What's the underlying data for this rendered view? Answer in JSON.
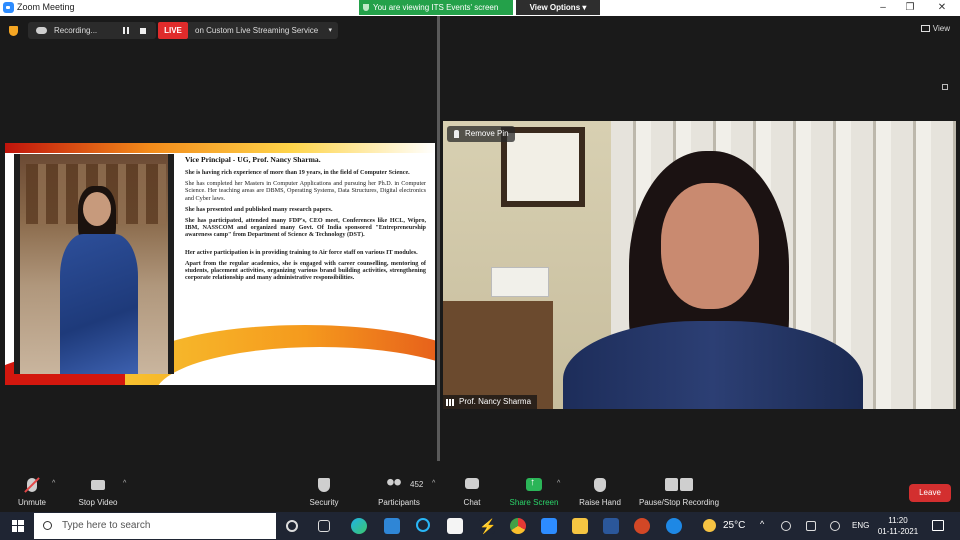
{
  "window": {
    "title": "Zoom Meeting",
    "viewing_banner": "You are viewing ITS Events' screen",
    "view_options": "View Options ▾",
    "minimize": "–",
    "restore": "❐",
    "close": "✕"
  },
  "recording": {
    "status": "Recording...",
    "live": "LIVE",
    "stream": "on Custom Live Streaming Service",
    "stream_caret": "▾"
  },
  "view_button": "View",
  "slide": {
    "heading": "Vice Principal - UG, Prof. Nancy Sharma.",
    "paragraphs": [
      "She is having rich experience of more than 19 years, in the field of Computer Science.",
      "She has completed her Masters in Computer Applications and pursuing her Ph.D. in Computer Science. Her teaching areas are DBMS, Operating Systems, Data Structures, Digital electronics and Cyber laws.",
      "She has presented and published many research papers.",
      "She has participated, attended many FDP's, CEO meet, Conferences like HCL, Wipro, IBM, NASSCOM and organized many Govt. Of India sponsored \"Entrepreneurship awareness camp\" from Department of Science & Technology (DST).",
      "Her active participation is in providing training to Air force staff on various IT modules.",
      "Apart from the regular academics, she is engaged with career counselling, mentoring of students, placement activities, organizing various brand building activities, strengthening corporate relationship and many administrative responsibilities."
    ]
  },
  "video": {
    "remove_pin": "Remove Pin",
    "participant_name": "Prof. Nancy Sharma"
  },
  "toolbar": {
    "unmute": "Unmute",
    "stop_video": "Stop Video",
    "security": "Security",
    "participants": "Participants",
    "participants_count": "452",
    "chat": "Chat",
    "share_screen": "Share Screen",
    "raise_hand": "Raise Hand",
    "pause_stop_recording": "Pause/Stop Recording",
    "leave": "Leave",
    "caret": "^"
  },
  "taskbar": {
    "search_placeholder": "Type here to search",
    "temperature": "25°C",
    "language": "ENG",
    "time": "11:20",
    "date": "01-11-2021"
  },
  "colors": {
    "share_green": "#2bb558",
    "live_red": "#e02b2b",
    "leave_red": "#d32f2f",
    "banner_green": "#24a14a"
  }
}
